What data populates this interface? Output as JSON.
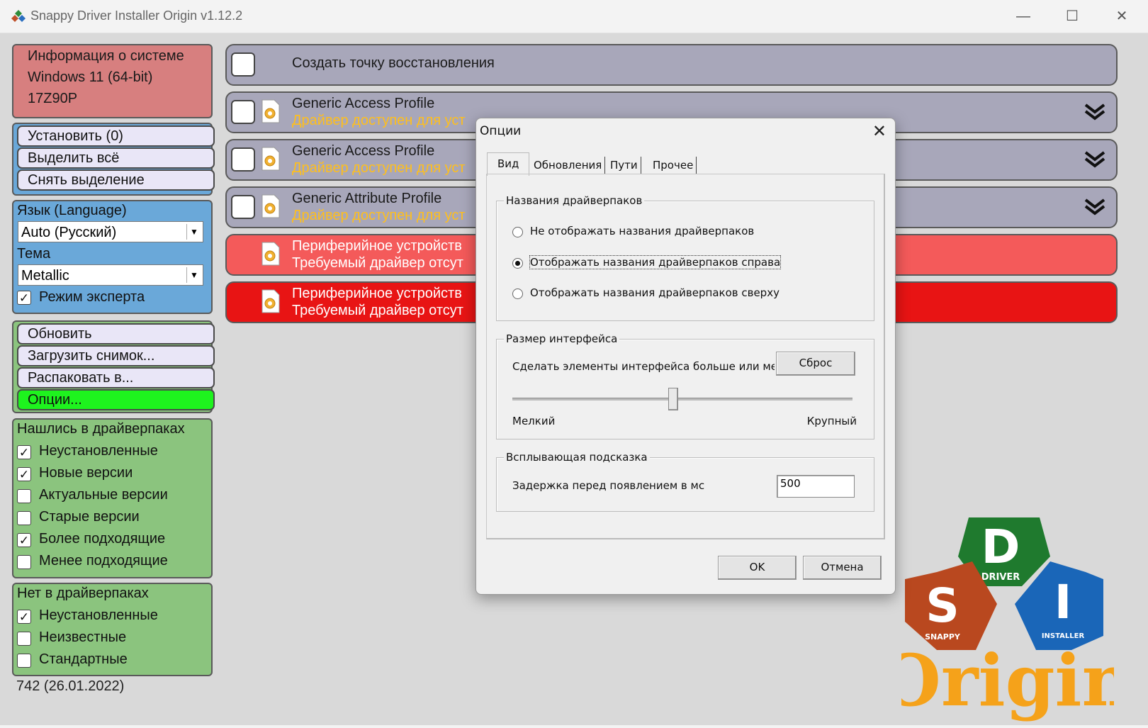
{
  "window": {
    "title": "Snappy Driver Installer Origin v1.12.2",
    "controls": [
      "minimize",
      "maximize",
      "close"
    ]
  },
  "sysinfo": {
    "title": "Информация о системе",
    "os": "Windows 11 (64-bit)",
    "model": "17Z90P"
  },
  "actions": {
    "install": "Установить (0)",
    "select_all": "Выделить всё",
    "deselect": "Снять выделение"
  },
  "settings": {
    "language_label": "Язык (Language)",
    "language_value": "Auto (Русский)",
    "theme_label": "Тема",
    "theme_value": "Metallic",
    "expert_mode_label": "Режим эксперта",
    "expert_mode": true
  },
  "tools": {
    "refresh": "Обновить",
    "load_snapshot": "Загрузить снимок...",
    "extract_to": "Распаковать в...",
    "options": "Опции..."
  },
  "found_filters": {
    "title": "Нашлись в драйверпаках",
    "items": [
      {
        "label": "Неустановленные",
        "checked": true
      },
      {
        "label": "Новые версии",
        "checked": true
      },
      {
        "label": "Актуальные версии",
        "checked": false
      },
      {
        "label": "Старые версии",
        "checked": false
      },
      {
        "label": "Более подходящие",
        "checked": true
      },
      {
        "label": "Менее подходящие",
        "checked": false
      }
    ]
  },
  "notfound_filters": {
    "title": "Нет в драйверпаках",
    "items": [
      {
        "label": "Неустановленные",
        "checked": true
      },
      {
        "label": "Неизвестные",
        "checked": false
      },
      {
        "label": "Стандартные",
        "checked": false
      }
    ]
  },
  "version_info": "742 (26.01.2022)",
  "drivers": [
    {
      "title": "Создать точку восстановления",
      "status": ""
    },
    {
      "title": "Generic Access Profile",
      "status": "Драйвер доступен для уст"
    },
    {
      "title": "Generic Access Profile",
      "status": "Драйвер доступен для уст"
    },
    {
      "title": "Generic Attribute Profile",
      "status": "Драйвер доступен для уст"
    },
    {
      "title": "Периферийное устройств",
      "status": "Требуемый драйвер отсут"
    },
    {
      "title": "Периферийное устройств",
      "status": "Требуемый драйвер отсут"
    }
  ],
  "dialog": {
    "title": "Опции",
    "tabs": [
      "Вид",
      "Обновления",
      "Пути",
      "Прочее"
    ],
    "active_tab": "Вид",
    "group_names": {
      "title": "Названия драйверпаков",
      "options": [
        {
          "label": "Не отображать названия драйверпаков",
          "selected": false
        },
        {
          "label": "Отображать названия драйверпаков справа",
          "selected": true
        },
        {
          "label": "Отображать названия драйверпаков сверху",
          "selected": false
        }
      ]
    },
    "group_size": {
      "title": "Размер интерфейса",
      "description": "Сделать элементы интерфейса больше или мень",
      "reset_label": "Сброс",
      "min_label": "Мелкий",
      "max_label": "Крупный",
      "slider_value": 0.47
    },
    "group_tooltip": {
      "title": "Всплывающая подсказка",
      "delay_label": "Задержка перед появлением в мс",
      "delay_value": "500"
    },
    "ok_label": "OK",
    "cancel_label": "Отмена"
  },
  "logo": {
    "letters": [
      "D",
      "S",
      "I"
    ],
    "words": [
      "DRIVER",
      "SNAPPY",
      "INSTALLER"
    ],
    "brand": "Origin"
  }
}
